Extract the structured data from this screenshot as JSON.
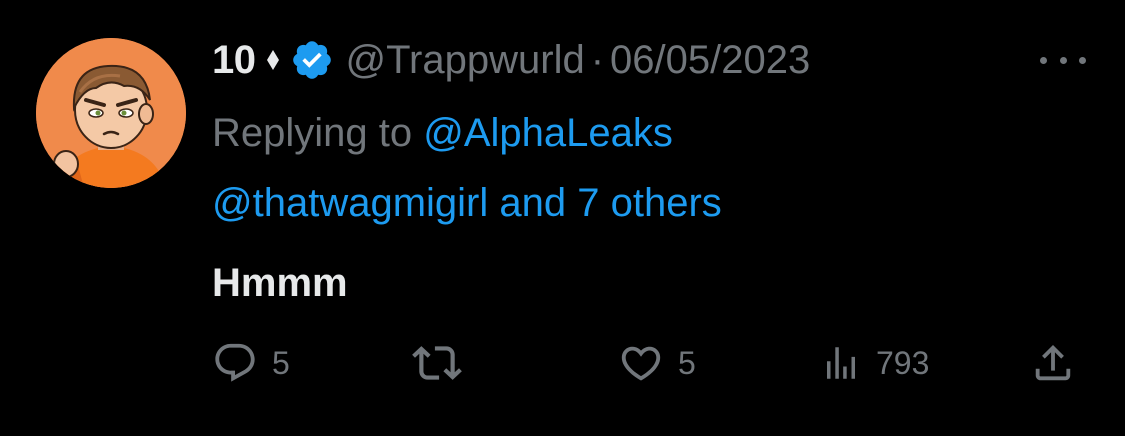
{
  "author": {
    "display_name": "10",
    "handle": "@Trappwurld",
    "separator": "·",
    "date": "06/05/2023",
    "avatar_icon": "cartoon-avatar-icon",
    "badge_icon": "diamond-icon",
    "verified_icon": "verified-badge-icon"
  },
  "reply_context": {
    "prefix": "Replying to",
    "first_mention": "@AlphaLeaks",
    "second_mention": "@thatwagmigirl",
    "and_others": "and 7 others"
  },
  "tweet": {
    "text": "Hmmm"
  },
  "actions": {
    "replies": "5",
    "likes": "5",
    "views": "793"
  },
  "colors": {
    "background": "#000000",
    "primary_text": "#e7e9ea",
    "secondary_text": "#71767b",
    "link": "#1d9bf0",
    "avatar_bg": "#f08a4b"
  }
}
